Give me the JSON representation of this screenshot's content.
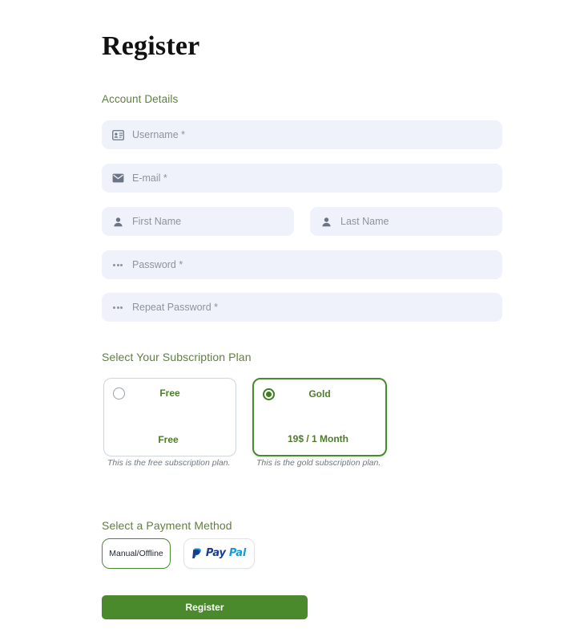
{
  "page": {
    "title": "Register"
  },
  "account_section": {
    "heading": "Account Details",
    "fields": [
      {
        "name": "username",
        "placeholder": "Username *",
        "icon": "contact-card-icon"
      },
      {
        "name": "email",
        "placeholder": "E-mail *",
        "icon": "envelope-icon"
      },
      {
        "name": "first_name",
        "placeholder": "First Name",
        "icon": "person-icon"
      },
      {
        "name": "last_name",
        "placeholder": "Last Name",
        "icon": "person-icon"
      },
      {
        "name": "password",
        "placeholder": "Password *",
        "icon": "dots-icon"
      },
      {
        "name": "repeat_password",
        "placeholder": "Repeat Password *",
        "icon": "dots-icon"
      }
    ]
  },
  "plan_section": {
    "heading": "Select Your Subscription Plan",
    "plans": [
      {
        "id": "free",
        "name": "Free",
        "price": "Free",
        "description": "This is the free subscription plan.",
        "selected": false
      },
      {
        "id": "gold",
        "name": "Gold",
        "price": "19$ / 1 Month",
        "description": "This is the gold subscription plan.",
        "selected": true
      }
    ]
  },
  "payment_section": {
    "heading": "Select a Payment Method",
    "methods": [
      {
        "id": "manual",
        "label": "Manual/Offline",
        "selected": true
      },
      {
        "id": "paypal",
        "label": "PayPal",
        "label_part_1": "Pay",
        "label_part_2": "Pal",
        "selected": false
      }
    ]
  },
  "submit": {
    "label": "Register"
  },
  "colors": {
    "accent_green": "#4b8a2c",
    "heading_green": "#5f7f3e",
    "plan_text_green": "#4c7c2b",
    "field_background": "#eff2fa",
    "placeholder_text": "#8c93a0",
    "paypal_dark": "#1b3d8f",
    "paypal_light": "#1899d6"
  }
}
